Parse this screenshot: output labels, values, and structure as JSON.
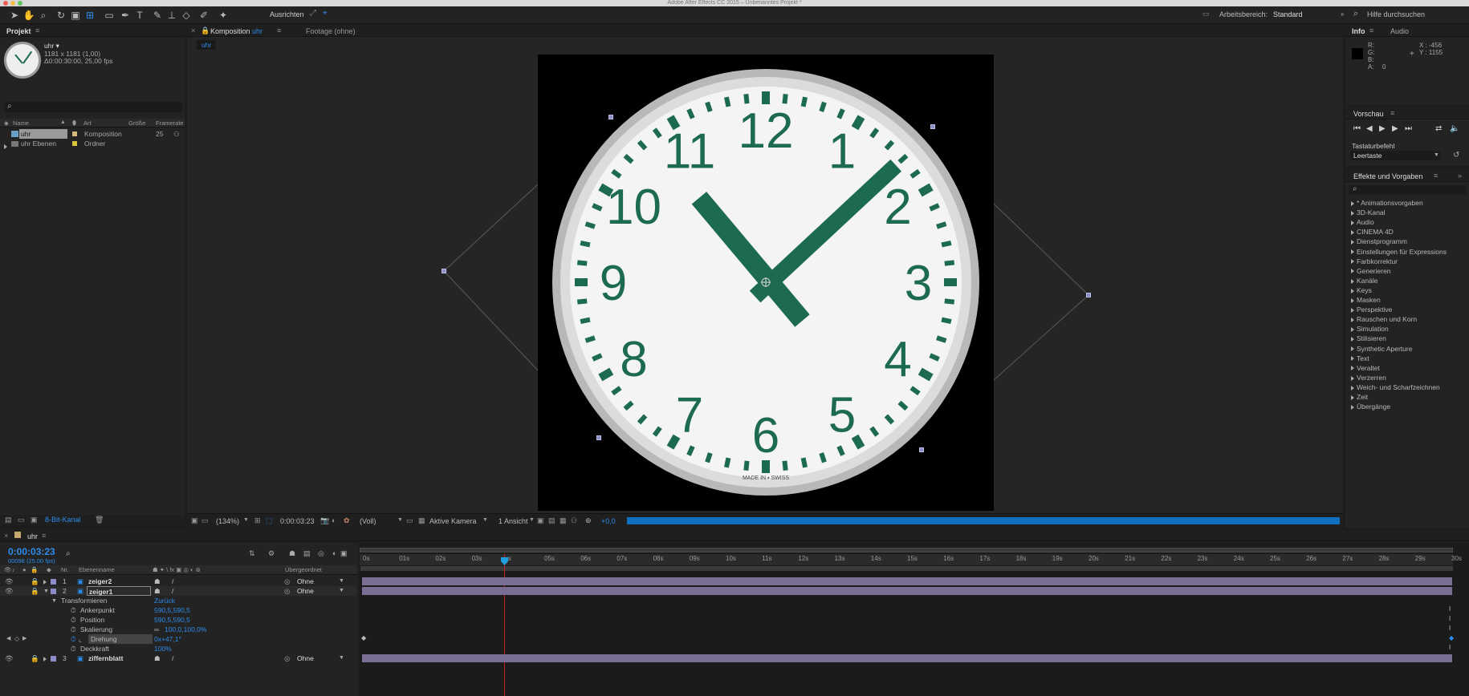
{
  "window": {
    "title": "Adobe After Effects CC 2015 – Unbenanntes Projekt *"
  },
  "toolbar": {
    "align_label": "Ausrichten",
    "workspace_label": "Arbeitsbereich:",
    "workspace_value": "Standard",
    "help_search": "Hilfe durchsuchen"
  },
  "project": {
    "tab": "Projekt",
    "item_name": "uhr ▾",
    "item_dims": "1181 x 1181 (1,00)",
    "item_duration": "Δ0:00:30:00, 25,00 fps",
    "columns": [
      "Name",
      "Art",
      "Größe",
      "Framerate"
    ],
    "rows": [
      {
        "name": "uhr",
        "type": "Komposition",
        "size": "",
        "fps": "25"
      },
      {
        "name": "uhr Ebenen",
        "type": "Ordner",
        "size": "",
        "fps": ""
      }
    ],
    "bit_depth": "8-Bit-Kanal"
  },
  "composition": {
    "close": "×",
    "tab_prefix": "Komposition",
    "tab_name": "uhr",
    "footage_tab": "Footage (ohne)",
    "breadcrumb": "uhr"
  },
  "viewer_bar": {
    "zoom": "(134%)",
    "timecode": "0:00:03:23",
    "resolution": "(Voll)",
    "camera": "Aktive Kamera",
    "views": "1 Ansicht",
    "exposure": "+0,0"
  },
  "clock": {
    "brand": "MADE IN ▪ SWISS"
  },
  "info": {
    "tab": "Info",
    "audio_tab": "Audio",
    "r_label": "R:",
    "g_label": "G:",
    "b_label": "B:",
    "a_label": "A:",
    "a_value": "0",
    "x_readout": "X : -456",
    "y_readout": "Y : 1155"
  },
  "preview": {
    "title": "Vorschau",
    "shortcut_label": "Tastaturbefehl",
    "shortcut_value": "Leertaste"
  },
  "effects": {
    "title": "Effekte und Vorgaben",
    "items": [
      "* Animationsvorgaben",
      "3D-Kanal",
      "Audio",
      "CINEMA 4D",
      "Dienstprogramm",
      "Einstellungen für Expressions",
      "Farbkorrektur",
      "Generieren",
      "Kanäle",
      "Keys",
      "Masken",
      "Perspektive",
      "Rauschen und Korn",
      "Simulation",
      "Stilisieren",
      "Synthetic Aperture",
      "Text",
      "Veraltet",
      "Verzerren",
      "Weich- und Scharfzeichnen",
      "Zeit",
      "Übergänge"
    ]
  },
  "timeline": {
    "close": "×",
    "tab": "uhr",
    "timecode": "0:00:03:23",
    "frames": "00098 (25.00 fps)",
    "col_nr": "Nr.",
    "col_name": "Ebenenname",
    "col_parent": "Übergeordnet",
    "ruler": [
      "0s",
      "01s",
      "02s",
      "03s",
      "s",
      "05s",
      "06s",
      "07s",
      "08s",
      "09s",
      "10s",
      "11s",
      "12s",
      "13s",
      "14s",
      "15s",
      "16s",
      "17s",
      "18s",
      "19s",
      "20s",
      "21s",
      "22s",
      "23s",
      "24s",
      "25s",
      "26s",
      "27s",
      "28s",
      "29s",
      "30s"
    ],
    "layers": [
      {
        "nr": "1",
        "name": "zeiger2",
        "parent": "Ohne"
      },
      {
        "nr": "2",
        "name": "zeiger1",
        "parent": "Ohne"
      },
      {
        "nr": "3",
        "name": "ziffernblatt",
        "parent": "Ohne"
      }
    ],
    "transform": {
      "label": "Transformieren",
      "reset": "Zurück",
      "props": [
        {
          "name": "Ankerpunkt",
          "value": "590,5,590,5"
        },
        {
          "name": "Position",
          "value": "590,5,590,5"
        },
        {
          "name": "Skalierung",
          "value": "100,0,100,0%"
        },
        {
          "name": "Drehung",
          "value": "0x+47,1°"
        },
        {
          "name": "Deckkraft",
          "value": "100%"
        }
      ]
    }
  }
}
